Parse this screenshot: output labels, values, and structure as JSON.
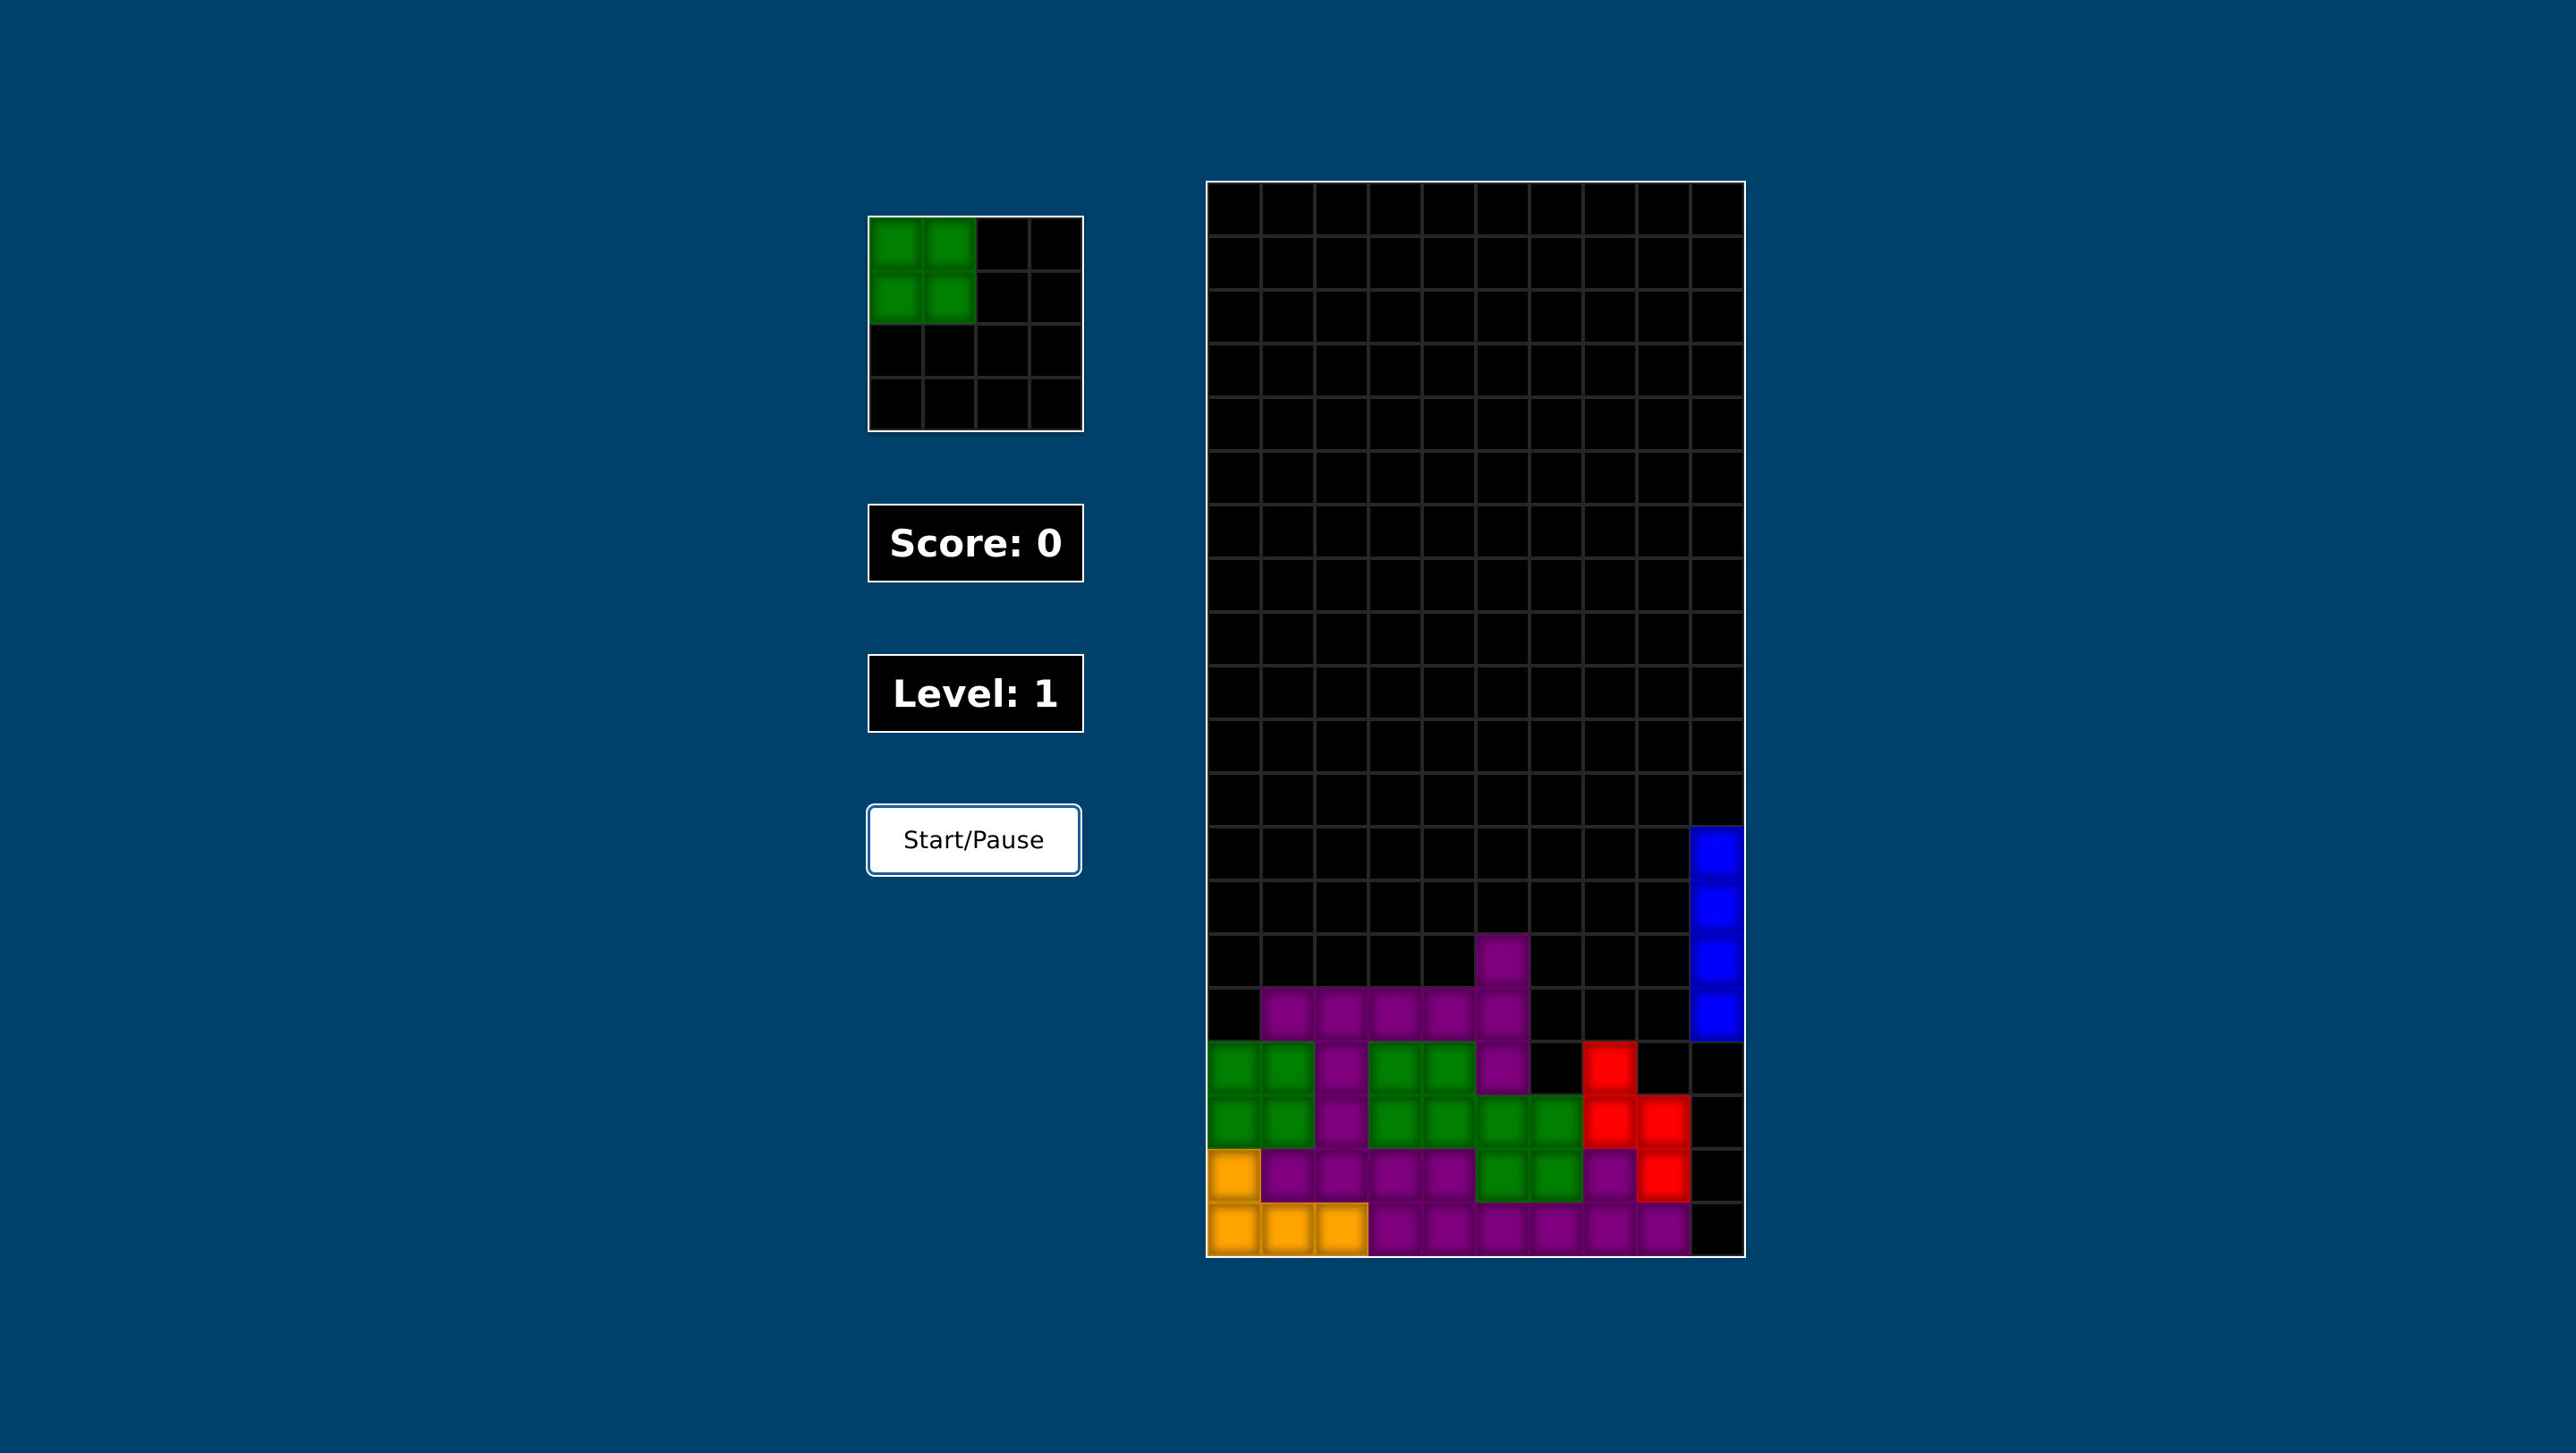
{
  "colors": {
    "background": "#00416b",
    "well": "#000000",
    "grid_line": "#262626",
    "G": "#008000",
    "P": "#800080",
    "R": "#ff0000",
    "B": "#0000ff",
    "O": "#ffa500"
  },
  "next_piece": {
    "rows": [
      "GG..",
      "GG..",
      "....",
      "...."
    ]
  },
  "score": {
    "label": "Score: 0"
  },
  "level": {
    "label": "Level: 1"
  },
  "controls": {
    "start_pause_label": "Start/Pause"
  },
  "board": {
    "columns": 10,
    "rows": [
      "..........",
      "..........",
      "..........",
      "..........",
      "..........",
      "..........",
      "..........",
      "..........",
      "..........",
      "..........",
      "..........",
      "..........",
      ".........B",
      ".........B",
      ".....P...B",
      ".PPPPP...B",
      "GGPGGP.R..",
      "GGPGGGGRR.",
      "OPPPPGGPR.",
      "OOOPPPPPP."
    ]
  }
}
